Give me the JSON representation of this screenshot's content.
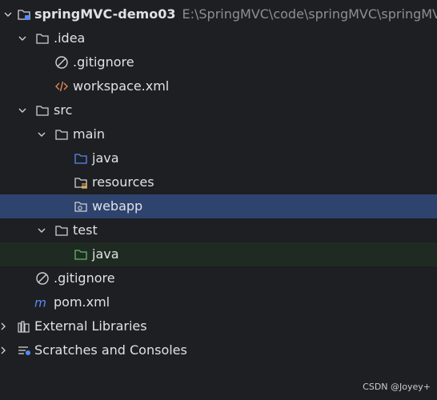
{
  "project": {
    "name": "springMVC-demo03",
    "path": "E:\\SpringMVC\\code\\springMVC\\springMV"
  },
  "items": {
    "idea": ".idea",
    "idea_gitignore": ".gitignore",
    "workspace": "workspace.xml",
    "src": "src",
    "main": "main",
    "java_main": "java",
    "resources": "resources",
    "webapp": "webapp",
    "test": "test",
    "java_test": "java",
    "root_gitignore": ".gitignore",
    "pom": "pom.xml",
    "external_libraries": "External Libraries",
    "scratches": "Scratches and Consoles"
  },
  "icons": {
    "project": "module-folder-icon",
    "folder": "folder-icon",
    "source_folder": "source-folder-icon",
    "resources_folder": "resources-folder-icon",
    "web_folder": "web-folder-icon",
    "test_source_folder": "test-source-folder-icon",
    "ignored_file": "ignored-file-icon",
    "xml_file": "xml-file-icon",
    "maven_file": "maven-icon",
    "libraries": "libraries-icon",
    "scratches": "scratches-icon"
  },
  "colors": {
    "background": "#1e1f22",
    "selection": "#2e436e",
    "test_row": "#1f2b22",
    "text": "#dfe1e5",
    "path_text": "#8c8f95",
    "source_blue": "#548af7",
    "test_green": "#5fb865",
    "xml_orange": "#e08855"
  },
  "watermark": "CSDN @Joyey+"
}
